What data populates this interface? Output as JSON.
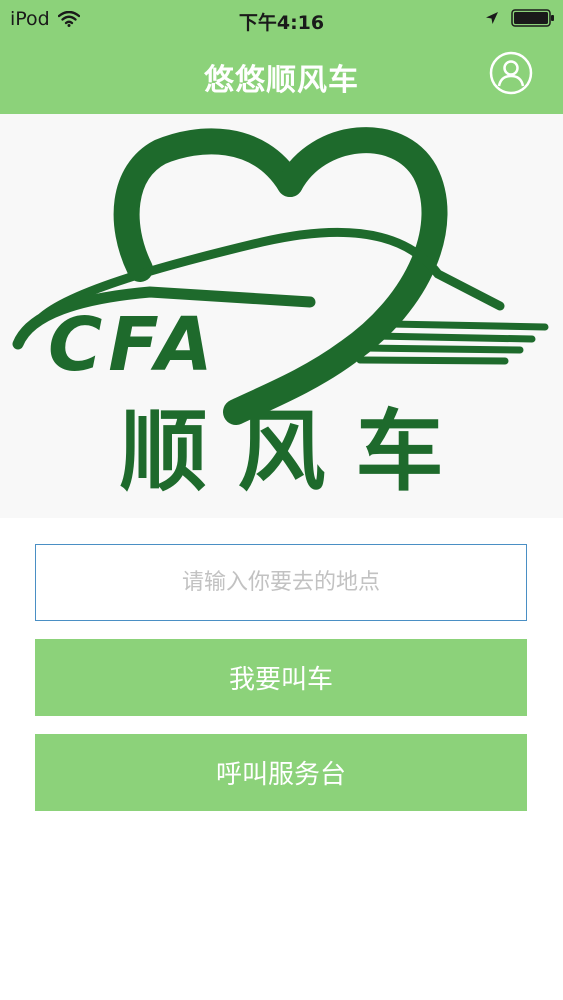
{
  "status_bar": {
    "device": "iPod",
    "time": "下午4:16",
    "icons": [
      "wifi-icon",
      "location-arrow-icon",
      "battery-icon"
    ]
  },
  "nav": {
    "title": "悠悠顺风车",
    "profile_icon": "user-profile-icon"
  },
  "banner": {
    "logo_text": "CFA",
    "logo_caption": "顺风车",
    "logo_color": "#1e6a2c"
  },
  "form": {
    "destination_placeholder": "请输入你要去的地点",
    "destination_value": "",
    "call_car_label": "我要叫车",
    "call_service_label": "呼叫服务台"
  },
  "colors": {
    "accent": "#8cd27a",
    "input_border": "#4a8fc4",
    "placeholder": "#c2c2c2"
  }
}
